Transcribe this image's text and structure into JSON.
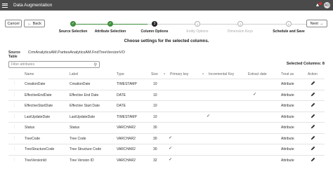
{
  "app": {
    "title": "Data Augmentation",
    "avatar_initials": "AD"
  },
  "toolbar": {
    "cancel_label": "Cancel",
    "back_label": "Back",
    "next_label": "Next"
  },
  "train": {
    "steps": [
      {
        "label": "Source Selection",
        "state": "done"
      },
      {
        "label": "Attribute Selection",
        "state": "done"
      },
      {
        "label": "Column Options",
        "state": "current",
        "number": "3"
      },
      {
        "label": "Entity Options",
        "state": "future",
        "number": "4"
      },
      {
        "label": "Dimension Keys",
        "state": "future",
        "number": "5"
      },
      {
        "label": "Schedule and Save",
        "state": "future",
        "number": "6"
      }
    ]
  },
  "main": {
    "heading": "Choose settings for the selected columns.",
    "source_table_label_1": "Source",
    "source_table_label_2": "Table",
    "source_table_value": "CrmAnalyticsAM.PartiesAnalyticsAM.FndTreeVersionVO",
    "filter_placeholder": "Filter attributes",
    "selected_count": "Selected Columns: 8"
  },
  "table": {
    "headers": {
      "name": "Name",
      "label": "Label",
      "type": "Type",
      "size": "Size",
      "primary_key": "Primary key",
      "incremental_key": "Incremental Key",
      "extract_date": "Extract date",
      "treat_as": "Treat as",
      "action": "Action"
    },
    "rows": [
      {
        "name": "CreationDate",
        "label": "CreationDate",
        "type": "TIMESTAMP",
        "size": "10",
        "primary_key": false,
        "incremental_key": false,
        "extract_date": false,
        "treat_as": "Attribute"
      },
      {
        "name": "EffectiveEndDate",
        "label": "Effective End Date",
        "type": "DATE",
        "size": "10",
        "primary_key": false,
        "incremental_key": false,
        "extract_date": true,
        "treat_as": "Attribute"
      },
      {
        "name": "EffectiveStartDate",
        "label": "Effective Start Date",
        "type": "DATE",
        "size": "10",
        "primary_key": false,
        "incremental_key": false,
        "extract_date": false,
        "treat_as": "Attribute"
      },
      {
        "name": "LastUpdateDate",
        "label": "LastUpdateDate",
        "type": "TIMESTAMP",
        "size": "10",
        "primary_key": false,
        "incremental_key": true,
        "extract_date": false,
        "treat_as": "Attribute"
      },
      {
        "name": "Status",
        "label": "Status",
        "type": "VARCHAR2",
        "size": "30",
        "primary_key": false,
        "incremental_key": false,
        "extract_date": false,
        "treat_as": "Attribute"
      },
      {
        "name": "TreeCode",
        "label": "Tree Code",
        "type": "VARCHAR2",
        "size": "30",
        "primary_key": true,
        "incremental_key": false,
        "extract_date": false,
        "treat_as": "Attribute"
      },
      {
        "name": "TreeStructureCode",
        "label": "Tree Structure Code",
        "type": "VARCHAR2",
        "size": "30",
        "primary_key": true,
        "incremental_key": false,
        "extract_date": false,
        "treat_as": "Attribute"
      },
      {
        "name": "TreeVersionId",
        "label": "Tree Version ID",
        "type": "VARCHAR2",
        "size": "32",
        "primary_key": true,
        "incremental_key": false,
        "extract_date": false,
        "treat_as": "Attribute"
      }
    ]
  },
  "colors": {
    "titlebar": "#4a4a4a",
    "done": "#3f8f3f",
    "current": "#222222"
  }
}
